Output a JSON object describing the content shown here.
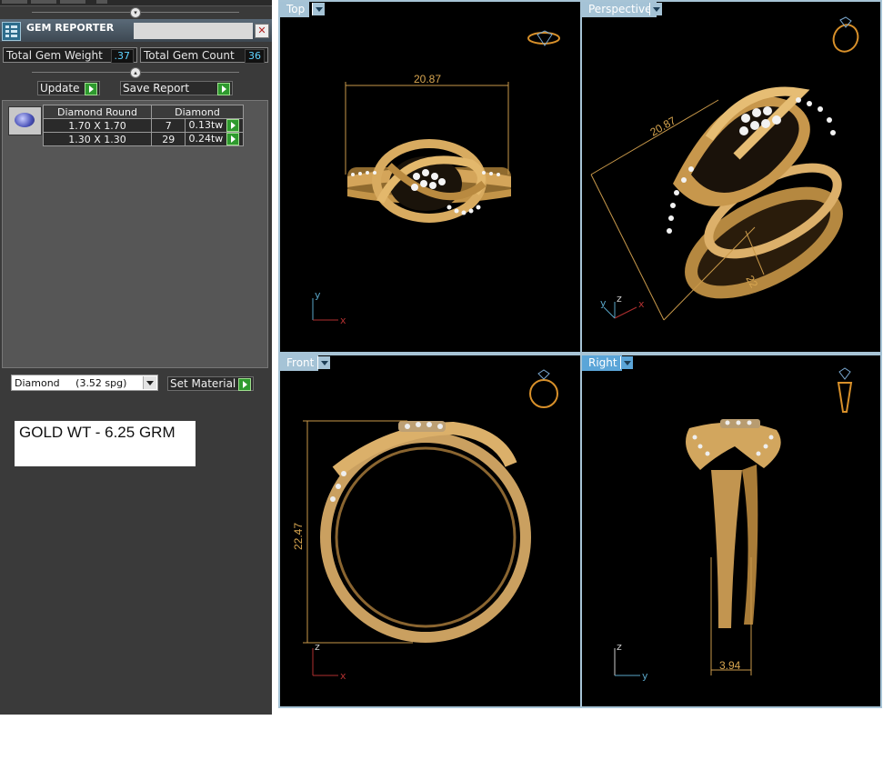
{
  "gem_reporter": {
    "title": "GEM REPORTER",
    "close_glyph": "✕",
    "total_gem_weight_label": "Total Gem Weight",
    "total_gem_weight_value": ".37",
    "total_gem_count_label": "Total Gem Count",
    "total_gem_count_value": "36",
    "update_label": "Update",
    "save_report_label": "Save Report",
    "table": {
      "headers": [
        "Diamond Round",
        "Diamond"
      ],
      "rows": [
        {
          "size": "1.70 X 1.70",
          "count": "7",
          "weight": "0.13tw"
        },
        {
          "size": "1.30 X 1.30",
          "count": "29",
          "weight": "0.24tw"
        }
      ]
    },
    "material_value": "Diamond     (3.52 spg)",
    "set_material_label": "Set Material",
    "gold_note": "GOLD WT - 6.25 GRM"
  },
  "viewports": {
    "top": {
      "label": "Top",
      "dimension": "20.87",
      "axis_x": "x",
      "axis_y": "y"
    },
    "perspective": {
      "label": "Perspective",
      "dimension": "20.87",
      "dimension2": "22",
      "axis_x": "x",
      "axis_y": "y",
      "axis_z": "z"
    },
    "front": {
      "label": "Front",
      "dimension": "22.47",
      "axis_x": "x",
      "axis_z": "z"
    },
    "right": {
      "label": "Right",
      "dimension": "3.94",
      "axis_y": "y",
      "axis_z": "z"
    }
  },
  "colors": {
    "panel": "#3a3a3a",
    "viewport_bg": "#000000",
    "gold": "#d4a55a",
    "dimension": "#d8a650",
    "tab_active": "#5ba5d8",
    "tab_inactive": "#a5c3d6"
  }
}
